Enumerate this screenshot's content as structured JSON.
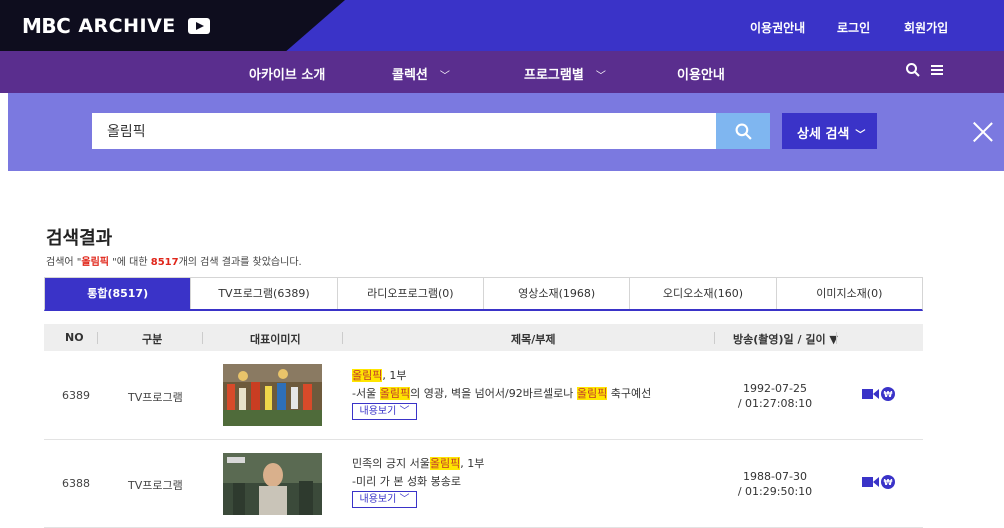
{
  "header": {
    "logo_brand": "MBC",
    "logo_text": "ARCHIVE",
    "links": [
      "이용권안내",
      "로그인",
      "회원가입"
    ]
  },
  "nav": {
    "items": [
      {
        "label": "아카이브 소개"
      },
      {
        "label": "콜렉션"
      },
      {
        "label": "프로그램별"
      },
      {
        "label": "이용안내"
      }
    ]
  },
  "search": {
    "value": "올림픽",
    "advanced_label": "상세 검색"
  },
  "results": {
    "title": "검색결과",
    "summary_prefix": "검색어 \"",
    "keyword": "올림픽",
    "summary_mid": " \"에 대한 ",
    "count": "8517",
    "summary_suffix": "개의 검색 결과를 찾았습니다."
  },
  "tabs": [
    {
      "label": "통합(8517)",
      "active": true
    },
    {
      "label": "TV프로그램(6389)"
    },
    {
      "label": "라디오프로그램(0)"
    },
    {
      "label": "영상소재(1968)"
    },
    {
      "label": "오디오소재(160)"
    },
    {
      "label": "이미지소재(0)"
    }
  ],
  "table": {
    "headers": {
      "no": "NO",
      "type": "구분",
      "image": "대표이미지",
      "title": "제목/부제",
      "date": "방송(촬영)일 / 길이 ▼"
    },
    "rows": [
      {
        "no": "6389",
        "type": "TV프로그램",
        "title_hl": "올림픽",
        "title_rest": ", 1부",
        "sub_pre": "-서울 ",
        "sub_hl1": "올림픽",
        "sub_mid": "의 영광, 벽을 넘어서/92바르셀로나 ",
        "sub_hl2": "올림픽",
        "sub_post": " 축구예선",
        "more": "내용보기",
        "date": "1992-07-25",
        "length": "/ 01:27:08:10"
      },
      {
        "no": "6388",
        "type": "TV프로그램",
        "title_pre": "민족의 긍지 서울",
        "title_hl": "올림픽",
        "title_rest": ", 1부",
        "sub": "-미리 가 본 성화 봉송로",
        "more": "내용보기",
        "date": "1988-07-30",
        "length": "/ 01:29:50:10"
      }
    ]
  },
  "colors": {
    "primary": "#3a33c8",
    "nav": "#5a2e8e",
    "search_band": "#7b79e0",
    "highlight": "#ffe600"
  }
}
